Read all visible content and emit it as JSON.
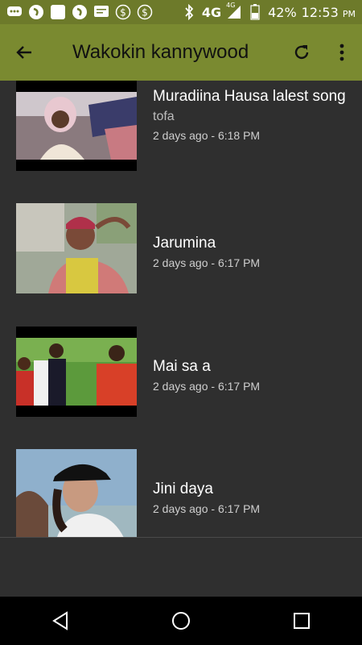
{
  "status_bar": {
    "network": "4G",
    "network_sup": "4G",
    "battery": "42%",
    "time": "12:53",
    "ampm": "PM",
    "icons": [
      "chat-icon",
      "app-icon",
      "square-icon",
      "app-icon",
      "message-icon",
      "dollar-icon",
      "dollar-icon",
      "bluetooth-icon",
      "signal-icon",
      "battery-icon"
    ]
  },
  "app_bar": {
    "title": "Wakokin kannywood",
    "colors": {
      "background": "#7a8a30",
      "status": "#6d7a2a"
    }
  },
  "videos": [
    {
      "title": "Muradiina Hausa lalest song",
      "author": "tofa",
      "time": "2 days ago - 6:18 PM"
    },
    {
      "title": "Jarumina",
      "author": "",
      "time": "2 days ago - 6:17 PM"
    },
    {
      "title": "Mai sa a",
      "author": "",
      "time": "2 days ago - 6:17 PM"
    },
    {
      "title": "Jini daya",
      "author": "",
      "time": "2 days ago - 6:17 PM"
    }
  ]
}
